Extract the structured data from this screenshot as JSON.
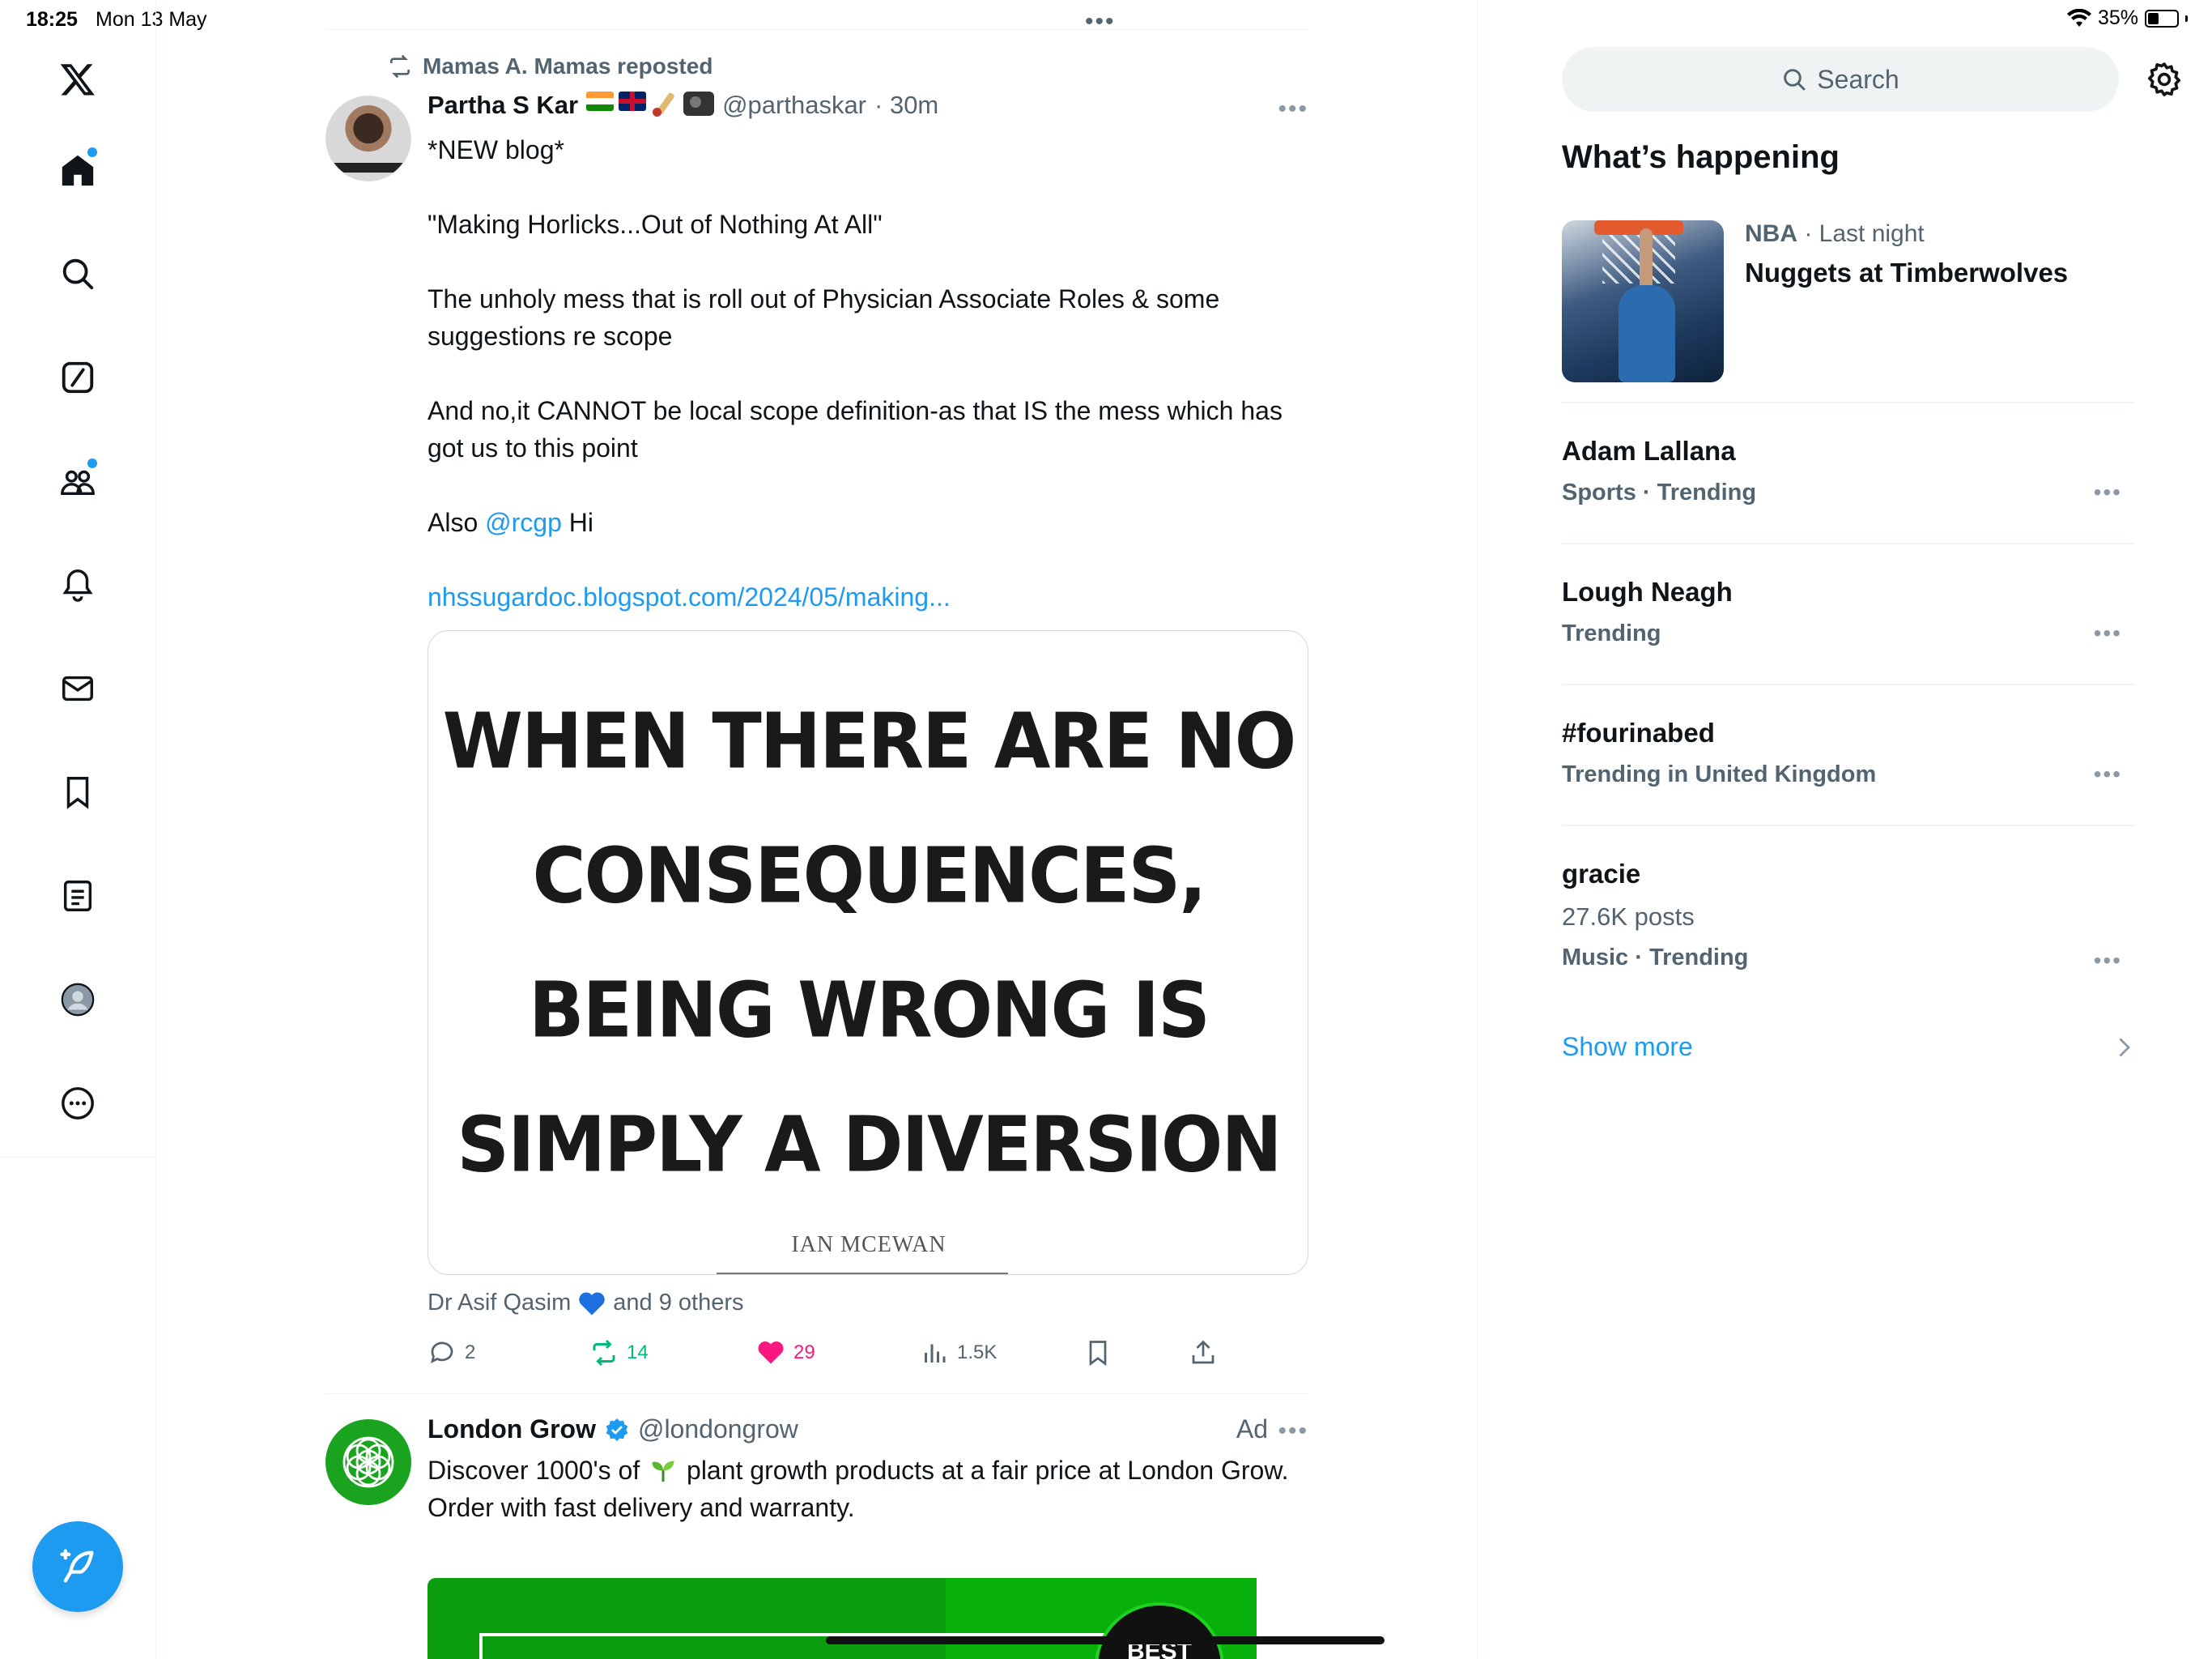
{
  "status_bar": {
    "time": "18:25",
    "date": "Mon 13 May",
    "battery": "35%"
  },
  "nav": {
    "items": [
      "x-logo",
      "home",
      "explore",
      "grok",
      "communities",
      "notifications",
      "messages",
      "bookmarks",
      "lists",
      "profile",
      "more"
    ],
    "accent": "#1d9bf0"
  },
  "feed": {
    "tweet1": {
      "repost_by": "Mamas A. Mamas reposted",
      "name": "Partha S Kar",
      "handle": "@parthaskar",
      "time": "· 30m",
      "lines": [
        "*NEW blog*",
        "",
        "\"Making Horlicks...Out of Nothing At All\"",
        "",
        "The unholy mess that is roll out of Physician Associate Roles & some suggestions re scope",
        "",
        "And no,it CANNOT be local scope definition-as that IS the mess which has got us to this point",
        ""
      ],
      "also_prefix": "Also",
      "mention": "@rcgp",
      "also_suffix": "Hi",
      "link": "nhssugardoc.blogspot.com/2024/05/making...",
      "image": {
        "quote_lines": [
          "WHEN THERE ARE NO",
          "CONSEQUENCES,",
          "BEING WRONG IS",
          "SIMPLY A DIVERSION"
        ],
        "author": "IAN MCEWAN"
      },
      "liked_by_name": "Dr Asif Qasim",
      "liked_by_suffix": "and 9 others",
      "stats": {
        "replies": "2",
        "reposts": "14",
        "likes": "29",
        "views": "1.5K"
      }
    },
    "tweet2": {
      "name": "London Grow",
      "handle": "@londongrow",
      "ad_label": "Ad",
      "text_before_emoji": "Discover 1000's of",
      "text_after_emoji": "plant growth products at a fair price at London Grow.",
      "line2": "Order with fast delivery and warranty.",
      "badge_text": "BEST"
    }
  },
  "sidebar": {
    "search_placeholder": "Search",
    "heading": "What’s happening",
    "featured": {
      "category": "NBA",
      "when": "· Last night",
      "title": "Nuggets at Timberwolves"
    },
    "trends": [
      {
        "title": "Adam Lallana",
        "context": "Sports · Trending",
        "posts": ""
      },
      {
        "title": "Lough Neagh",
        "context": "Trending",
        "posts": ""
      },
      {
        "title": "#fourinabed",
        "context": "Trending in United Kingdom",
        "posts": ""
      },
      {
        "title": "gracie",
        "posts": "27.6K posts",
        "context": "Music · Trending"
      }
    ],
    "show_more": "Show more"
  },
  "colors": {
    "like": "#f91880",
    "repost": "#00ba7c",
    "link": "#1d9bf0",
    "muted": "#536471"
  }
}
